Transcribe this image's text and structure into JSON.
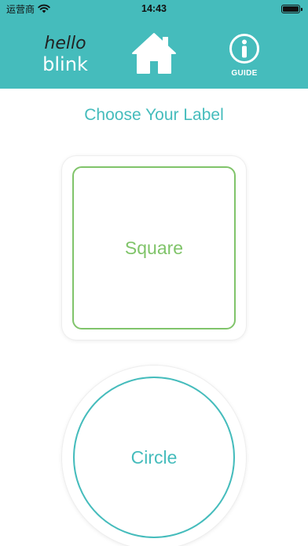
{
  "status_bar": {
    "carrier": "运营商",
    "time": "14:43",
    "battery_level": 1.0,
    "icons": [
      "wifi-icon",
      "battery-icon"
    ]
  },
  "header": {
    "logo_line1": "hello",
    "logo_line2": "blink",
    "home_icon": "home-icon",
    "guide_icon": "info-icon",
    "guide_label": "GUIDE"
  },
  "main": {
    "title": "Choose Your Label",
    "options": [
      {
        "label": "Square",
        "color": "#80c46a"
      },
      {
        "label": "Circle",
        "color": "#45bcbc"
      }
    ]
  },
  "colors": {
    "brand": "#45bcbc",
    "square_green": "#80c46a",
    "background": "#ffffff"
  }
}
